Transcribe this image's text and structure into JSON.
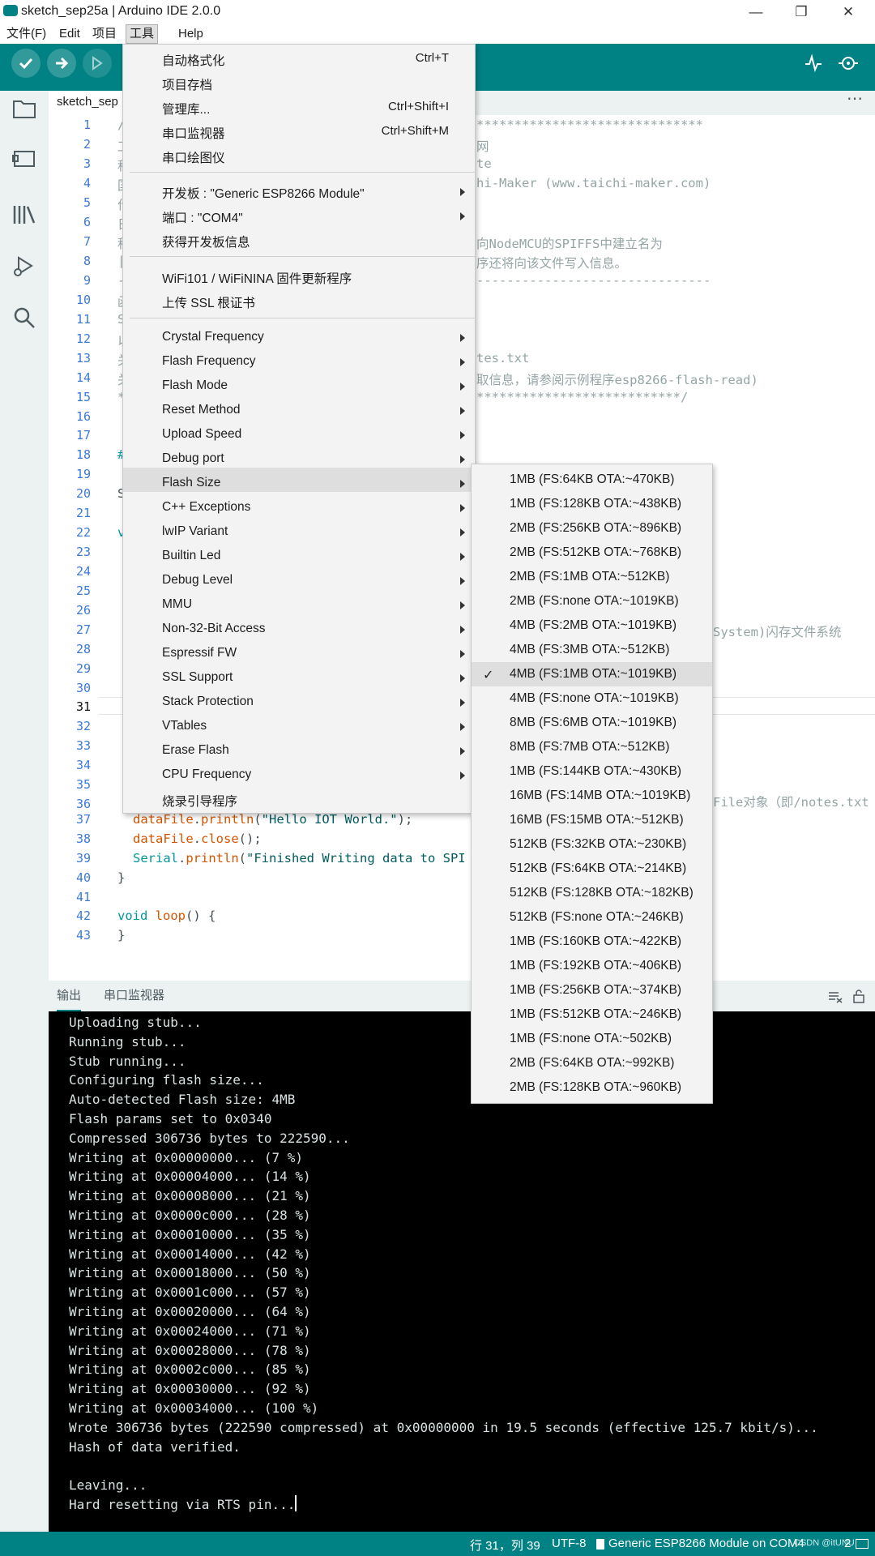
{
  "window": {
    "title": "sketch_sep25a | Arduino IDE 2.0.0"
  },
  "menubar": [
    "文件(F)",
    "Edit",
    "项目",
    "工具",
    "Help"
  ],
  "tab": {
    "label": "sketch_sep"
  },
  "tools_menu": {
    "items": [
      {
        "label": "自动格式化",
        "shortcut": "Ctrl+T"
      },
      {
        "label": "项目存档"
      },
      {
        "label": "管理库...",
        "shortcut": "Ctrl+Shift+I"
      },
      {
        "label": "串口监视器",
        "shortcut": "Ctrl+Shift+M"
      },
      {
        "label": "串口绘图仪"
      },
      {
        "label": "开发板 : \"Generic ESP8266 Module\""
      },
      {
        "label": "端口 : \"COM4\""
      },
      {
        "label": "获得开发板信息"
      },
      {
        "label": "WiFi101 / WiFiNINA 固件更新程序"
      },
      {
        "label": "上传 SSL 根证书"
      },
      {
        "label": "Crystal Frequency"
      },
      {
        "label": "Flash Frequency"
      },
      {
        "label": "Flash Mode"
      },
      {
        "label": "Reset Method"
      },
      {
        "label": "Upload Speed"
      },
      {
        "label": "Debug port"
      },
      {
        "label": "Flash Size"
      },
      {
        "label": "C++ Exceptions"
      },
      {
        "label": "lwIP Variant"
      },
      {
        "label": "Builtin Led"
      },
      {
        "label": "Debug Level"
      },
      {
        "label": "MMU"
      },
      {
        "label": "Non-32-Bit Access"
      },
      {
        "label": "Espressif FW"
      },
      {
        "label": "SSL Support"
      },
      {
        "label": "Stack Protection"
      },
      {
        "label": "VTables"
      },
      {
        "label": "Erase Flash"
      },
      {
        "label": "CPU Frequency"
      },
      {
        "label": "烧录引导程序"
      }
    ]
  },
  "flash_size_menu": {
    "selected": "4MB (FS:1MB OTA:~1019KB)",
    "items": [
      "1MB (FS:64KB OTA:~470KB)",
      "1MB (FS:128KB OTA:~438KB)",
      "2MB (FS:256KB OTA:~896KB)",
      "2MB (FS:512KB OTA:~768KB)",
      "2MB (FS:1MB OTA:~512KB)",
      "2MB (FS:none OTA:~1019KB)",
      "4MB (FS:2MB OTA:~1019KB)",
      "4MB (FS:3MB OTA:~512KB)",
      "4MB (FS:1MB OTA:~1019KB)",
      "4MB (FS:none OTA:~1019KB)",
      "8MB (FS:6MB OTA:~1019KB)",
      "8MB (FS:7MB OTA:~512KB)",
      "1MB (FS:144KB OTA:~430KB)",
      "16MB (FS:14MB OTA:~1019KB)",
      "16MB (FS:15MB OTA:~512KB)",
      "512KB (FS:32KB OTA:~230KB)",
      "512KB (FS:64KB OTA:~214KB)",
      "512KB (FS:128KB OTA:~182KB)",
      "512KB (FS:none OTA:~246KB)",
      "1MB (FS:160KB OTA:~422KB)",
      "1MB (FS:192KB OTA:~406KB)",
      "1MB (FS:256KB OTA:~374KB)",
      "1MB (FS:512KB OTA:~246KB)",
      "1MB (FS:none OTA:~502KB)",
      "2MB (FS:64KB OTA:~992KB)",
      "2MB (FS:128KB OTA:~960KB)"
    ]
  },
  "editor": {
    "line_numbers": [
      "1",
      "2",
      "3",
      "4",
      "5",
      "6",
      "7",
      "8",
      "9",
      "10",
      "11",
      "12",
      "13",
      "14",
      "15",
      "16",
      "17",
      "18",
      "19",
      "20",
      "21",
      "22",
      "23",
      "24",
      "25",
      "26",
      "27",
      "28",
      "29",
      "30",
      "31",
      "32",
      "33",
      "34",
      "35",
      "36",
      "37",
      "38",
      "39",
      "40",
      "41",
      "42",
      "43"
    ],
    "current_line": "31",
    "visible_fragments": {
      "l1_left": "/",
      "l1": "******************************",
      "l2_left": "工",
      "l2": "网",
      "l3_left": "程",
      "l3": "te",
      "l4_left": "国",
      "l4": "hi-Maker (www.taichi-maker.com)",
      "l5_left": "作",
      "l6_left": "日",
      "l7_left": "程",
      "l7": "向NodeMCU的SPIFFS中建立名为",
      "l8_left": "|",
      "l8": "序还将向该文件写入信息。",
      "l9_left": "-",
      "l9": "-------------------------------",
      "l10_left": "函",
      "l11_left": "S",
      "l12_left": "以",
      "l13_left": "关",
      "l13": "tes.txt",
      "l14_left": "关",
      "l14": "取信息，请参阅示例程序esp8266-flash-read)",
      "l15_left": "*",
      "l15": "***************************/",
      "l18_left": "#",
      "l20_left": "S",
      "l22_left": "v",
      "l27": "System)闪存文件系统",
      "l36": "File对象（即/notes.txt"
    },
    "line37": {
      "obj": "dataFile",
      "method": "println",
      "str": "\"Hello IOT World.\"",
      "end": ");"
    },
    "line38": {
      "obj": "dataFile",
      "method": "close",
      "end": "();"
    },
    "line39": {
      "obj": "Serial",
      "method": "println",
      "str": "\"Finished Writing data to SPI"
    },
    "line40": "}",
    "line42": {
      "kw": "void",
      "fn": "loop",
      "rest": "() {"
    },
    "line43": "}"
  },
  "output": {
    "tabs": [
      "输出",
      "串口监视器"
    ],
    "lines": [
      "Uploading stub...",
      "Running stub...",
      "Stub running...",
      "Configuring flash size...",
      "Auto-detected Flash size: 4MB",
      "Flash params set to 0x0340",
      "Compressed 306736 bytes to 222590...",
      "Writing at 0x00000000... (7 %)",
      "Writing at 0x00004000... (14 %)",
      "Writing at 0x00008000... (21 %)",
      "Writing at 0x0000c000... (28 %)",
      "Writing at 0x00010000... (35 %)",
      "Writing at 0x00014000... (42 %)",
      "Writing at 0x00018000... (50 %)",
      "Writing at 0x0001c000... (57 %)",
      "Writing at 0x00020000... (64 %)",
      "Writing at 0x00024000... (71 %)",
      "Writing at 0x00028000... (78 %)",
      "Writing at 0x0002c000... (85 %)",
      "Writing at 0x00030000... (92 %)",
      "Writing at 0x00034000... (100 %)",
      "Wrote 306736 bytes (222590 compressed) at 0x00000000 in 19.5 seconds (effective 125.7 kbit/s)...",
      "Hash of data verified.",
      "",
      "Leaving...",
      "Hard resetting via RTS pin..."
    ]
  },
  "status": {
    "position": "行 31，列 39",
    "encoding": "UTF-8",
    "board": "Generic ESP8266 Module on COM4",
    "watermark": "CSDN @itUNU",
    "count": "2"
  },
  "colors": {
    "accent": "#008184",
    "console_bg": "#000000"
  }
}
